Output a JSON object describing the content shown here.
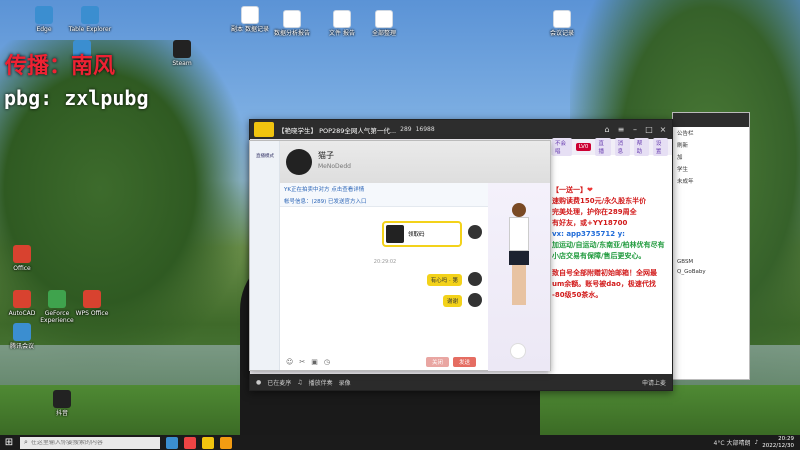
{
  "watermark": {
    "line1": "传播：南风",
    "line2": "pbg: zxlpubg"
  },
  "desktop_icons": [
    {
      "label": "Edge",
      "kind": "ic-app"
    },
    {
      "label": "Table Explorer",
      "kind": "ic-app"
    },
    {
      "label": "副本 数据记录",
      "kind": "ic-doc"
    },
    {
      "label": "数据分析报告",
      "kind": "ic-doc"
    },
    {
      "label": "文件 报告",
      "kind": "ic-doc"
    },
    {
      "label": "全部整理",
      "kind": "ic-doc"
    },
    {
      "label": "会议记录",
      "kind": "ic-doc"
    },
    {
      "label": "QQ",
      "kind": "ic-app"
    },
    {
      "label": "Steam",
      "kind": "ic-dark"
    },
    {
      "label": "Office",
      "kind": "ic-red"
    },
    {
      "label": "AutoCAD",
      "kind": "ic-red"
    },
    {
      "label": "GeForce Experience",
      "kind": "ic-green"
    },
    {
      "label": "WPS Office",
      "kind": "ic-red"
    },
    {
      "label": "腾讯会议",
      "kind": "ic-app"
    },
    {
      "label": "抖音",
      "kind": "ic-dark"
    }
  ],
  "app": {
    "title": "【艳晓学生】 POP289全网人气第一代...",
    "online_count": "289",
    "fans_count": "16988",
    "room_tabs": [
      "不会唱",
      "LV0",
      "直播",
      "消息",
      "帮助",
      "设置"
    ],
    "notice": {
      "line1": "【一送一】",
      "line2": "速购读费150元/永久股东半价",
      "line3": "完美处理，护你在289周全",
      "line4": "有好友，或+YY18700",
      "line5": "vx: app3735712 y:",
      "line6": "加运动/自运动/东南亚/柏林优有尽有",
      "line7": "小店交易有保障/售后更安心。",
      "line8": "致自号全部附赠初始邮箱！全网最",
      "line9": "um余额。账号被dao，极速代找",
      "line10": "-80级50茶水。"
    },
    "bottom": {
      "mic": "已在麦序",
      "music": "播放伴奏",
      "record": "录像",
      "apply": "申请上麦"
    }
  },
  "chat": {
    "left_label": "直播模式",
    "name": "猫子",
    "subtitle": "MeNoDedd",
    "info1": "YK正在拍卖中对方  点击查看详情",
    "info2": "帐号信息：(289)    已发送官方入口",
    "card_label": "领取码",
    "time1": "20:29:02",
    "bubble1": "有心吗 · 第",
    "bubble2": "谢谢",
    "close_btn": "关闭",
    "send_btn": "发送"
  },
  "side": {
    "lines": [
      "公告栏",
      "刷新",
      "加",
      "学生",
      "未成年",
      "GBSM",
      "Q_GoBaby"
    ]
  },
  "taskbar": {
    "search_placeholder": "在这里输入你要搜索的内容",
    "weather": "4°C 大部晴朗",
    "time": "20:29",
    "date": "2022/12/30"
  }
}
